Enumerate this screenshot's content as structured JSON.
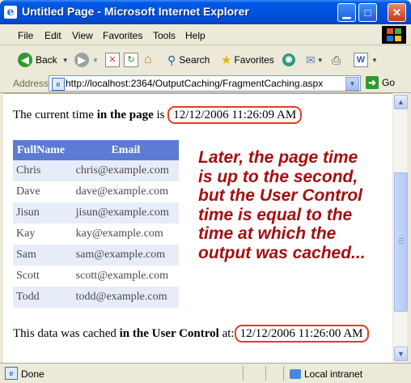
{
  "window": {
    "title": "Untitled Page - Microsoft Internet Explorer",
    "icon": "ie-icon",
    "controls": {
      "minimize": "minimize-icon",
      "maximize": "maximize-icon",
      "close": "close-icon"
    }
  },
  "menu": {
    "items": [
      "File",
      "Edit",
      "View",
      "Favorites",
      "Tools",
      "Help"
    ]
  },
  "toolbar": {
    "back_label": "Back",
    "search_label": "Search",
    "favorites_label": "Favorites"
  },
  "address": {
    "label": "Address",
    "url": "http://localhost:2364/OutputCaching/FragmentCaching.aspx",
    "go_label": "Go"
  },
  "page": {
    "time_prefix": "The current time ",
    "time_bold": "in the page",
    "time_suffix": " is ",
    "page_time": "12/12/2006 11:26:09 AM",
    "table": {
      "headers": [
        "FullName",
        "Email"
      ],
      "rows": [
        [
          "Chris",
          "chris@example.com"
        ],
        [
          "Dave",
          "dave@example.com"
        ],
        [
          "Jisun",
          "jisun@example.com"
        ],
        [
          "Kay",
          "kay@example.com"
        ],
        [
          "Sam",
          "sam@example.com"
        ],
        [
          "Scott",
          "scott@example.com"
        ],
        [
          "Todd",
          "todd@example.com"
        ]
      ]
    },
    "cached_prefix": "This data was cached ",
    "cached_bold": "in the User Control",
    "cached_suffix": " at:",
    "cached_time": "12/12/2006 11:26:00 AM",
    "callout": "Later, the page time is up to the second, but the User Control time is equal to the time at which the output was cached..."
  },
  "status": {
    "text": "Done",
    "zone": "Local intranet"
  },
  "colors": {
    "header_bg": "#5d7bd3",
    "alt_row_bg": "#e7ecf9",
    "highlight_border": "#e0401c",
    "callout_text": "#a50f0f"
  }
}
